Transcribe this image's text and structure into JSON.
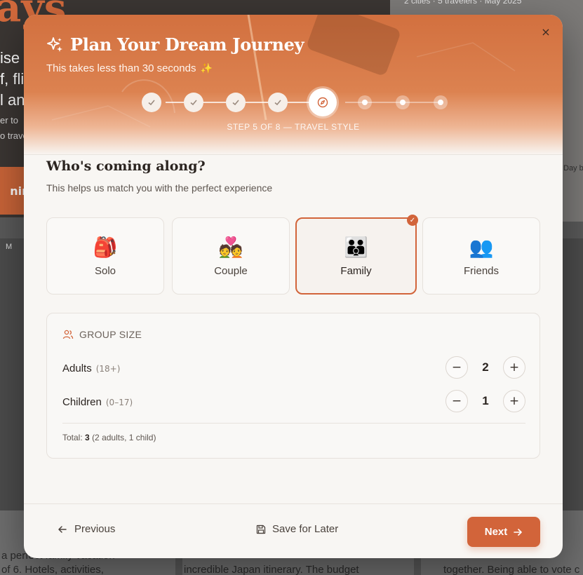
{
  "background": {
    "heading": "ays",
    "lines": [
      "ise",
      "f, flig",
      "l an",
      "er to",
      "o trave"
    ],
    "button_label": "ning",
    "meta": "2 cities · 5 travelers · May 2025",
    "day_label": "Day b",
    "side_label": "M",
    "cards": [
      "a perfect family vacation",
      "of 6. Hotels, activities,",
      "incredible Japan itinerary. The budget",
      "together. Being able to vote c"
    ]
  },
  "modal": {
    "title": "Plan Your Dream Journey",
    "subtitle": "This takes less than 30 seconds",
    "close_icon": "×",
    "step_caption": "STEP 5 OF 8 — TRAVEL STYLE",
    "current_step": 5,
    "total_steps": 8,
    "accent_color": "#d2643a"
  },
  "question": {
    "title": "Who's coming along?",
    "subtitle": "This helps us match you with the perfect experience"
  },
  "options": [
    {
      "label": "Solo",
      "icon": "🎒",
      "selected": false
    },
    {
      "label": "Couple",
      "icon": "💑",
      "selected": false
    },
    {
      "label": "Family",
      "icon": "👪",
      "selected": true
    },
    {
      "label": "Friends",
      "icon": "👥",
      "selected": false
    }
  ],
  "group": {
    "header": "GROUP SIZE",
    "adults": {
      "label": "Adults",
      "hint": "(18+)",
      "value": "2"
    },
    "children": {
      "label": "Children",
      "hint": "(0–17)",
      "value": "1"
    },
    "total_label": "Total:",
    "total_value": "3",
    "total_detail": "(2 adults, 1 child)"
  },
  "footer": {
    "previous_label": "Previous",
    "save_label": "Save for Later",
    "next_label": "Next"
  }
}
